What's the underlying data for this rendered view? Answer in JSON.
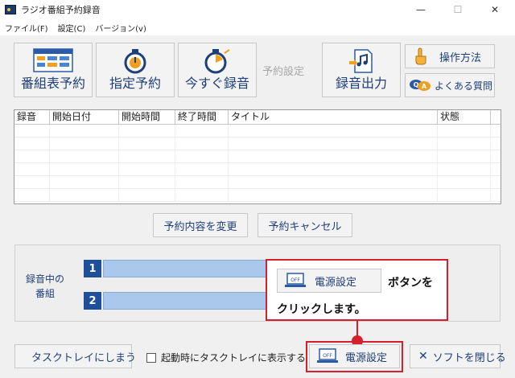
{
  "window": {
    "title": "ラジオ番組予約録音",
    "controls": {
      "minimize": "—",
      "maximize": "☐",
      "close": "✕"
    }
  },
  "menu": [
    {
      "label": "ファイル(F)"
    },
    {
      "label": "設定(C)"
    },
    {
      "label": "バージョン(v)"
    }
  ],
  "toolbar": {
    "schedule_table_label": "番組表予約",
    "timer_label": "指定予約",
    "record_now_label": "今すぐ録音",
    "reservation_settings_label": "予約設定",
    "export_label": "録音出力",
    "howto_label": "操作方法",
    "faq_label": "よくある質問"
  },
  "table": {
    "columns": [
      "録音",
      "開始日付",
      "開始時間",
      "終了時間",
      "タイトル",
      "状態"
    ],
    "rows": []
  },
  "actions": {
    "change_label": "予約内容を変更",
    "cancel_label": "予約キャンセル"
  },
  "recording": {
    "label_line1": "録音中の",
    "label_line2": "番組",
    "slots": [
      "1",
      "2"
    ]
  },
  "callout": {
    "button_label": "電源設定",
    "text1": "ボタンを",
    "text2": "クリックします。"
  },
  "bottom": {
    "tasktray_label": "タスクトレイにしまう",
    "startup_checkbox_label": "起動時にタスクトレイに表示する",
    "power_label": "電源設定",
    "close_label": "ソフトを閉じる"
  },
  "colors": {
    "accent": "#1f3f78",
    "highlight": "#d61f2b",
    "bar": "#a9c8ec"
  }
}
